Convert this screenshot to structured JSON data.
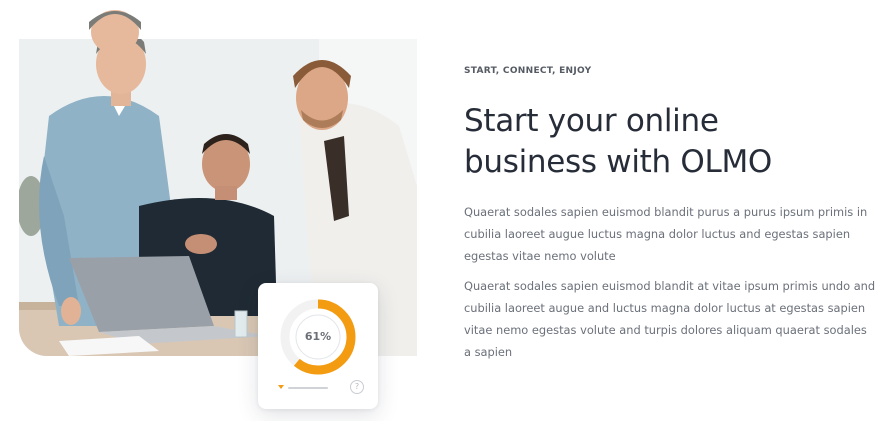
{
  "hero": {
    "eyebrow": "START, CONNECT, ENJOY",
    "title_line1": "Start your online",
    "title_line2": "business with OLMO",
    "paragraphs": [
      "Quaerat sodales sapien euismod blandit purus a purus ipsum primis in cubilia laoreet augue luctus magna dolor luctus and egestas sapien egestas vitae nemo volute",
      "Quaerat sodales sapien euismod blandit at vitae ipsum primis undo and cubilia laoreet augue and luctus magna dolor luctus at egestas sapien vitae nemo egestas volute and turpis dolores aliquam quaerat sodales a sapien"
    ]
  },
  "progress_card": {
    "percent_label": "61%",
    "percent_value": 61,
    "help_icon_glyph": "?",
    "icons": [
      "caret-down-icon",
      "help-icon"
    ]
  },
  "colors": {
    "accent_orange": "#f39c12",
    "heading": "#272d38",
    "body_text": "#6b707a",
    "ring_track": "#f2f2f2"
  }
}
